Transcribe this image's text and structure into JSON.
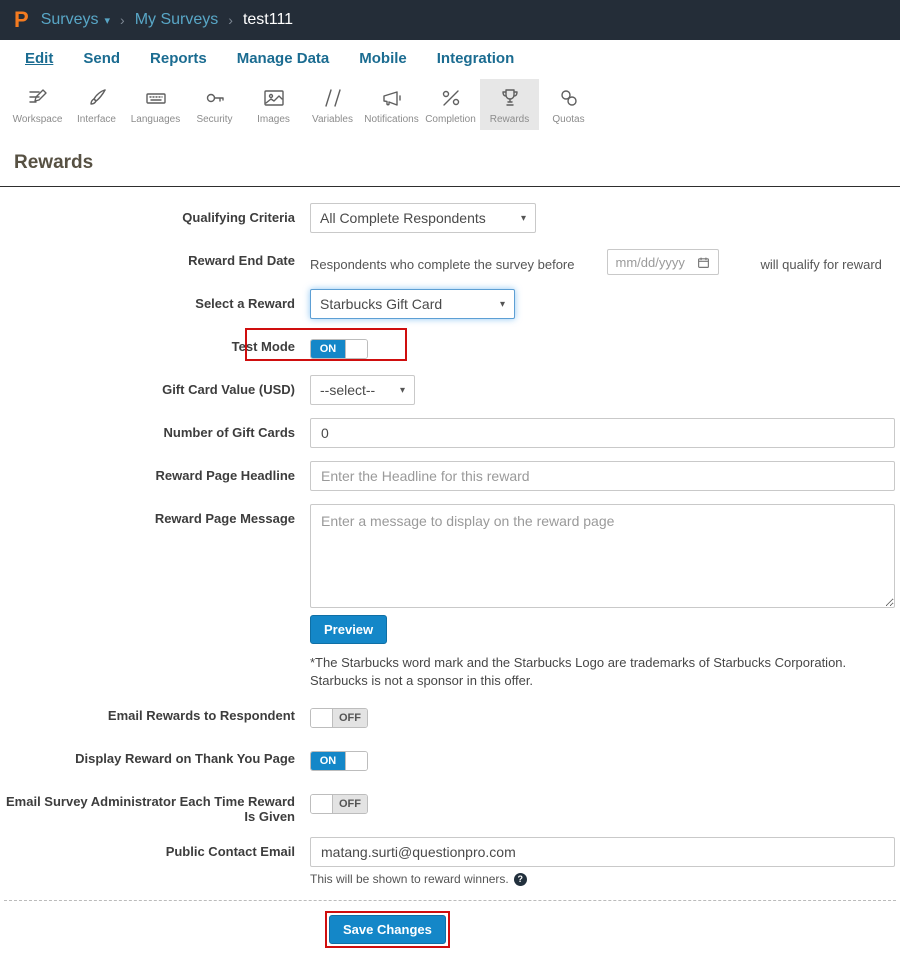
{
  "colors": {
    "header_bg": "#242d38",
    "accent_blue": "#1487c8",
    "logo_orange": "#f47b20",
    "link_teal": "#1b6c91",
    "breadcrumb_blue": "#58a6c6",
    "highlight_red": "#cf0e0e"
  },
  "icons": {
    "caret_down": "▾",
    "separator": "›",
    "help": "?"
  },
  "header": {
    "logo_text": "P",
    "breadcrumb": {
      "surveys": "Surveys",
      "my_surveys": "My Surveys",
      "survey_name": "test111"
    }
  },
  "menu": {
    "items": [
      {
        "label": "Edit",
        "active": true
      },
      {
        "label": "Send",
        "active": false
      },
      {
        "label": "Reports",
        "active": false
      },
      {
        "label": "Manage Data",
        "active": false
      },
      {
        "label": "Mobile",
        "active": false
      },
      {
        "label": "Integration",
        "active": false
      }
    ]
  },
  "toolbar": {
    "items": [
      {
        "label": "Workspace",
        "icon": "workspace-icon"
      },
      {
        "label": "Interface",
        "icon": "interface-icon"
      },
      {
        "label": "Languages",
        "icon": "languages-icon"
      },
      {
        "label": "Security",
        "icon": "security-icon"
      },
      {
        "label": "Images",
        "icon": "images-icon"
      },
      {
        "label": "Variables",
        "icon": "variables-icon"
      },
      {
        "label": "Notifications",
        "icon": "notifications-icon"
      },
      {
        "label": "Completion",
        "icon": "completion-icon"
      },
      {
        "label": "Rewards",
        "icon": "rewards-icon",
        "active": true
      },
      {
        "label": "Quotas",
        "icon": "quotas-icon"
      }
    ]
  },
  "page": {
    "title": "Rewards"
  },
  "form": {
    "qualifying_criteria": {
      "label": "Qualifying Criteria",
      "value": "All Complete Respondents"
    },
    "reward_end_date": {
      "label": "Reward End Date",
      "prefix": "Respondents who complete the survey before",
      "placeholder": "mm/dd/yyyy",
      "suffix": "will qualify for reward"
    },
    "select_reward": {
      "label": "Select a Reward",
      "value": "Starbucks Gift Card"
    },
    "test_mode": {
      "label": "Test Mode",
      "state": "ON"
    },
    "gift_card_value": {
      "label": "Gift Card Value (USD)",
      "value": "--select--"
    },
    "number_gift_cards": {
      "label": "Number of Gift Cards",
      "value": "0"
    },
    "headline": {
      "label": "Reward Page Headline",
      "placeholder": "Enter the Headline for this reward"
    },
    "message": {
      "label": "Reward Page Message",
      "placeholder": "Enter a message to display on the reward page"
    },
    "preview_button": "Preview",
    "disclaimer": "*The Starbucks word mark and the Starbucks Logo are trademarks of Starbucks Corporation. Starbucks is not a sponsor in this offer.",
    "email_rewards": {
      "label": "Email Rewards to Respondent",
      "state": "OFF"
    },
    "display_reward": {
      "label": "Display Reward on Thank You Page",
      "state": "ON"
    },
    "email_admin": {
      "label": "Email Survey Administrator Each Time Reward Is Given",
      "state": "OFF"
    },
    "public_email": {
      "label": "Public Contact Email",
      "value": "matang.surti@questionpro.com",
      "helper": "This will be shown to reward winners."
    },
    "save_button": "Save Changes"
  }
}
